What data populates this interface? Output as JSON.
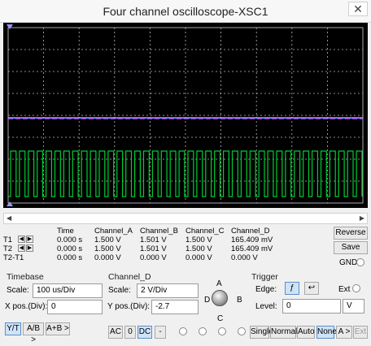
{
  "window": {
    "title": "Four channel oscilloscope-XSC1",
    "close_glyph": "✕"
  },
  "trace_colors": {
    "grid": "#b8b8b8",
    "green": "#00cc33",
    "white": "#ffffff",
    "magenta": "#ff33ff",
    "blue": "#4d7fff",
    "cursor": "#9999ff"
  },
  "readout": {
    "headers": [
      "Time",
      "Channel_A",
      "Channel_B",
      "Channel_C",
      "Channel_D"
    ],
    "rows": [
      {
        "label": "T1",
        "time": "0.000 s",
        "a": "1.500 V",
        "b": "1.501 V",
        "c": "1.500 V",
        "d": "165.409 mV"
      },
      {
        "label": "T2",
        "time": "0.000 s",
        "a": "1.500 V",
        "b": "1.501 V",
        "c": "1.500 V",
        "d": "165.409 mV"
      },
      {
        "label": "T2-T1",
        "time": "0.000 s",
        "a": "0.000 V",
        "b": "0.000 V",
        "c": "0.000 V",
        "d": "0.000 V"
      }
    ],
    "reverse_label": "Reverse",
    "save_label": "Save",
    "gnd_label": "GND"
  },
  "timebase": {
    "title": "Timebase",
    "scale_label": "Scale:",
    "scale_value": "100 us/Div",
    "xpos_label": "X pos.(Div):",
    "xpos_value": "0",
    "buttons": [
      "Y/T",
      "A/B >",
      "A+B >"
    ]
  },
  "channel": {
    "title": "Channel_D",
    "scale_label": "Scale:",
    "scale_value": "2  V/Div",
    "ypos_label": "Y pos.(Div):",
    "ypos_value": "-2.7",
    "coupling": [
      "AC",
      "0",
      "DC",
      "-"
    ],
    "knob_labels": {
      "a": "A",
      "b": "B",
      "c": "C",
      "d": "D"
    }
  },
  "trigger": {
    "title": "Trigger",
    "edge_label": "Edge:",
    "ext_label": "Ext",
    "level_label": "Level:",
    "level_value": "0",
    "level_unit": "V",
    "modes": [
      "Single",
      "Normal",
      "Auto",
      "None",
      "A >",
      "Ext"
    ]
  }
}
